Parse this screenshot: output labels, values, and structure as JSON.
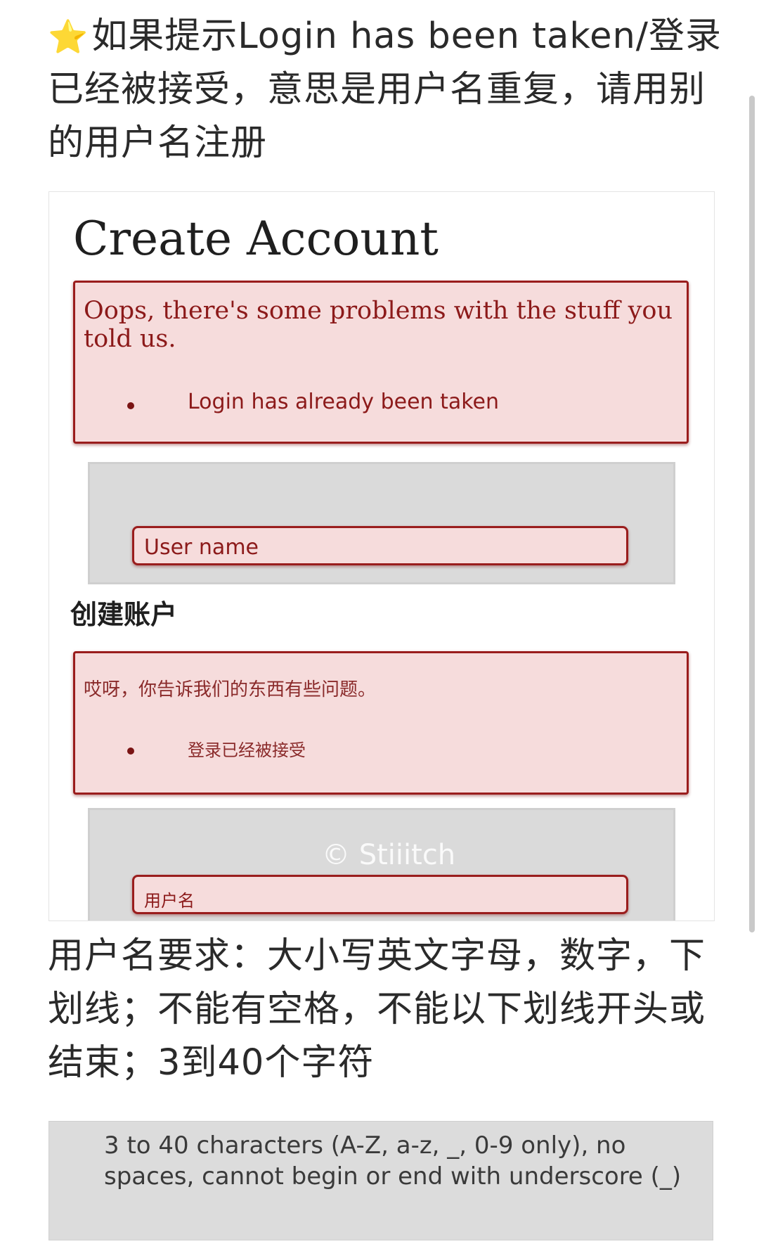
{
  "intro": {
    "star_icon": "⭐",
    "text": "如果提示Login has been taken/登录已经被接受，意思是用户名重复，请用别的用户名注册"
  },
  "shot": {
    "title": "Create Account",
    "error_en": {
      "message": "Oops, there's some problems with the stuff you told us.",
      "item": "Login has already been taken"
    },
    "username_placeholder_en": "User name",
    "title_zh": "创建账户",
    "error_zh": {
      "message": "哎呀，你告诉我们的东西有些问题。",
      "item": "登录已经被接受"
    },
    "username_placeholder_zh": "用户名",
    "watermark": "© Stiiitch"
  },
  "requirements": {
    "text": "用户名要求：大小写英文字母，数字，下划线；不能有空格，不能以下划线开头或结束；3到40个字符"
  },
  "hint": {
    "text": "3 to 40 characters (A-Z, a-z, _, 0-9 only), no spaces, cannot begin or end with underscore (_)"
  },
  "colors": {
    "error_border": "#9a1d1d",
    "error_background": "#f6dcdc",
    "error_text": "#8c1a1a",
    "panel_gray": "#dadada"
  }
}
